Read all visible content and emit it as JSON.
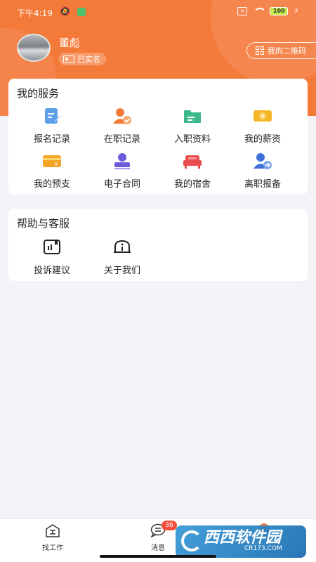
{
  "status_bar": {
    "time": "下午4:19",
    "battery": "100"
  },
  "profile": {
    "name": "董彪",
    "verified_label": "已实名",
    "qr_button_label": "我的二维码"
  },
  "services": {
    "title": "我的服务",
    "items": [
      {
        "label": "报名记录",
        "icon": "signup-record-icon"
      },
      {
        "label": "在职记录",
        "icon": "employment-record-icon"
      },
      {
        "label": "入职资料",
        "icon": "onboarding-docs-icon"
      },
      {
        "label": "我的薪资",
        "icon": "salary-icon"
      },
      {
        "label": "我的预支",
        "icon": "advance-pay-icon"
      },
      {
        "label": "电子合同",
        "icon": "e-contract-icon"
      },
      {
        "label": "我的宿舍",
        "icon": "dormitory-icon"
      },
      {
        "label": "离职报备",
        "icon": "resignation-icon"
      }
    ]
  },
  "help": {
    "title": "帮助与客服",
    "items": [
      {
        "label": "投诉建议",
        "icon": "complaint-icon"
      },
      {
        "label": "关于我们",
        "icon": "about-us-icon"
      }
    ]
  },
  "bottom_nav": {
    "items": [
      {
        "label": "找工作",
        "icon": "find-job-icon"
      },
      {
        "label": "消息",
        "icon": "message-icon",
        "badge": "36"
      }
    ]
  },
  "watermark": {
    "brand": "西西软件园",
    "site": "CR173.COM"
  },
  "colors": {
    "primary": "#f47a3a",
    "blue": "#3f8fe6",
    "green": "#3db98a",
    "yellow": "#f5b728",
    "purple": "#6a5bd8",
    "red": "#e94c4c"
  }
}
